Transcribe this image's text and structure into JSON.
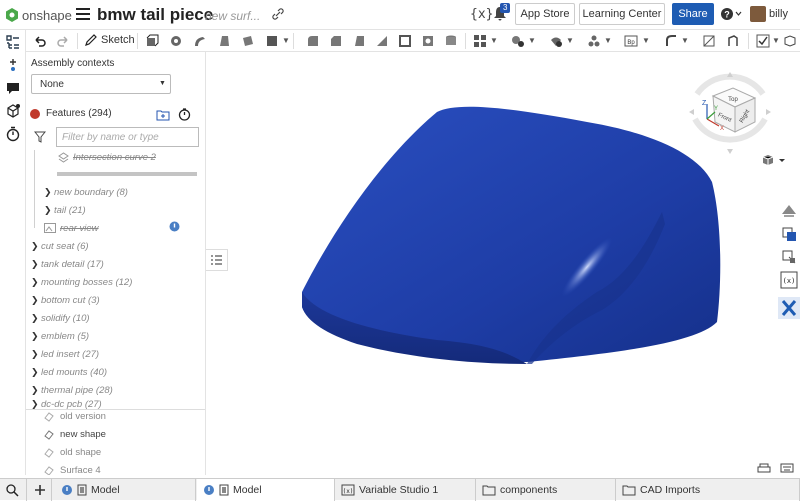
{
  "header": {
    "logo_text": "onshape",
    "doc_title": "bmw tail piece",
    "doc_subtitle": "new surf...",
    "vars_label": "{x}",
    "notification_count": "3",
    "app_store": "App Store",
    "learning_center": "Learning Center",
    "share": "Share",
    "user": "billy"
  },
  "toolbar": {
    "sketch_label": "Sketch"
  },
  "panel": {
    "assembly_contexts_label": "Assembly contexts",
    "assembly_context_value": "None",
    "features_label": "Features (294)",
    "filter_placeholder": "Filter by name or type",
    "rows": [
      {
        "label": "Intersection curve 2",
        "strike": true,
        "indent": 1
      },
      {
        "label": "new boundary (8)",
        "chev": true,
        "indent": 1
      },
      {
        "label": "tail (21)",
        "chev": true,
        "indent": 1
      },
      {
        "label": "rear view",
        "strike": true,
        "indent": 1
      },
      {
        "label": "cut seat (6)",
        "chev": true,
        "indent": 0
      },
      {
        "label": "tank detail (17)",
        "chev": true,
        "indent": 0
      },
      {
        "label": "mounting bosses (12)",
        "chev": true,
        "indent": 0
      },
      {
        "label": "bottom cut (3)",
        "chev": true,
        "indent": 0
      },
      {
        "label": "solidify (10)",
        "chev": true,
        "indent": 0
      },
      {
        "label": "emblem (5)",
        "chev": true,
        "indent": 0
      },
      {
        "label": "led insert (27)",
        "chev": true,
        "indent": 0
      },
      {
        "label": "led mounts (40)",
        "chev": true,
        "indent": 0
      },
      {
        "label": "thermal pipe (28)",
        "chev": true,
        "indent": 0
      },
      {
        "label": "dc-dc pcb (27)",
        "chev": true,
        "indent": 0
      }
    ],
    "parts": [
      {
        "label": "old version",
        "light": true
      },
      {
        "label": "new shape",
        "light": false
      },
      {
        "label": "old shape",
        "light": true
      },
      {
        "label": "Surface 4",
        "light": true
      }
    ]
  },
  "viewcube": {
    "top": "Top",
    "front": "Front",
    "right": "Right",
    "axis_x": "X",
    "axis_y": "Y",
    "axis_z": "Z"
  },
  "tabs": [
    {
      "label": "Model",
      "icon": "part-studio-icon",
      "active": false
    },
    {
      "label": "Model",
      "icon": "part-studio-icon",
      "active": true
    },
    {
      "label": "Variable Studio 1",
      "icon": "variable-studio-icon",
      "active": false
    },
    {
      "label": "components",
      "icon": "folder-icon",
      "active": false
    },
    {
      "label": "CAD Imports",
      "icon": "folder-icon",
      "active": false
    }
  ],
  "colors": {
    "brand_blue": "#1e5cb3",
    "model_blue": "#1f3fa8",
    "feature_error_red": "#c0392b"
  }
}
